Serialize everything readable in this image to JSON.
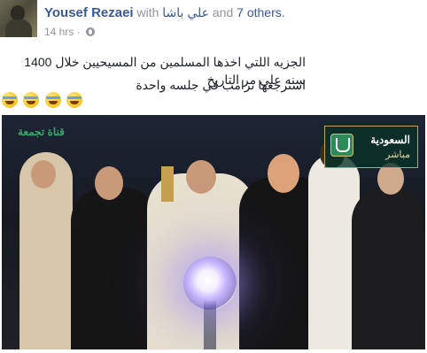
{
  "post": {
    "author": "Yousef Rezaei",
    "with_word": "with",
    "tagged_person": "علي باشا",
    "and_word": "and",
    "others": "7 others.",
    "time": "14 hrs",
    "dot": "·",
    "lines": [
      "الجزيه اللتي اخذها المسلمين من المسيحيين خلال 1400 سنه علي مر التاريخ",
      "استرجعها ترامب في جلسه واحدة"
    ],
    "emojis": [
      "face-with-tears-of-joy",
      "face-with-tears-of-joy",
      "face-with-tears-of-joy",
      "face-with-tears-of-joy"
    ]
  },
  "photo": {
    "channel_name": "السعودية",
    "channel_live": "مباشر",
    "watermark": "قناة تجمعة"
  },
  "colors": {
    "author": "#3b5998",
    "muted": "#90949c",
    "text": "#1d2129"
  }
}
